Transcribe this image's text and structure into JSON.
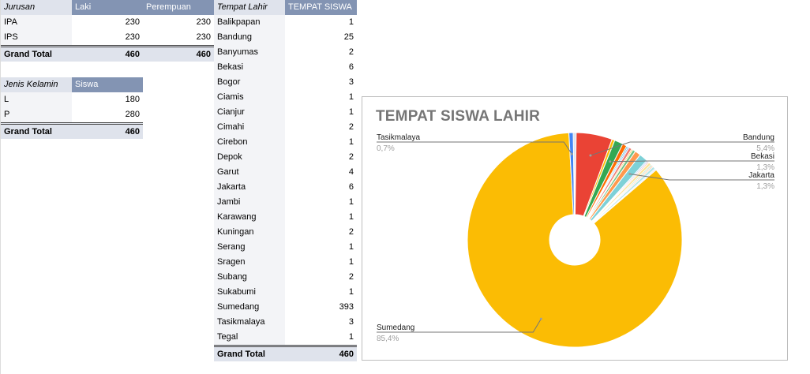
{
  "jurusan_table": {
    "headers": [
      "Jurusan",
      "Laki",
      "Perempuan"
    ],
    "rows": [
      {
        "label": "IPA",
        "laki": "230",
        "perempuan": "230"
      },
      {
        "label": "IPS",
        "laki": "230",
        "perempuan": "230"
      }
    ],
    "total": {
      "label": "Grand Total",
      "laki": "460",
      "perempuan": "460"
    }
  },
  "gender_table": {
    "headers": [
      "Jenis Kelamin",
      "Siswa"
    ],
    "rows": [
      {
        "label": "L",
        "value": "180"
      },
      {
        "label": "P",
        "value": "280"
      }
    ],
    "total": {
      "label": "Grand Total",
      "value": "460"
    }
  },
  "tempat_table": {
    "headers": [
      "Tempat Lahir",
      "TEMPAT SISWA"
    ],
    "rows": [
      {
        "label": "Balikpapan",
        "value": "1"
      },
      {
        "label": "Bandung",
        "value": "25"
      },
      {
        "label": "Banyumas",
        "value": "2"
      },
      {
        "label": "Bekasi",
        "value": "6"
      },
      {
        "label": "Bogor",
        "value": "3"
      },
      {
        "label": "Ciamis",
        "value": "1"
      },
      {
        "label": "Cianjur",
        "value": "1"
      },
      {
        "label": "Cimahi",
        "value": "2"
      },
      {
        "label": "Cirebon",
        "value": "1"
      },
      {
        "label": "Depok",
        "value": "2"
      },
      {
        "label": "Garut",
        "value": "4"
      },
      {
        "label": "Jakarta",
        "value": "6"
      },
      {
        "label": "Jambi",
        "value": "1"
      },
      {
        "label": "Karawang",
        "value": "1"
      },
      {
        "label": "Kuningan",
        "value": "2"
      },
      {
        "label": "Serang",
        "value": "1"
      },
      {
        "label": "Sragen",
        "value": "1"
      },
      {
        "label": "Subang",
        "value": "2"
      },
      {
        "label": "Sukabumi",
        "value": "1"
      },
      {
        "label": "Sumedang",
        "value": "393"
      },
      {
        "label": "Tasikmalaya",
        "value": "3"
      },
      {
        "label": "Tegal",
        "value": "1"
      }
    ],
    "total": {
      "label": "Grand Total",
      "value": "460"
    }
  },
  "chart_data": {
    "type": "pie",
    "donut": true,
    "title": "TEMPAT SISWA LAHIR",
    "slices": [
      {
        "name": "Balikpapan",
        "value": 1,
        "color": "#a8c4e6"
      },
      {
        "name": "Bandung",
        "value": 25,
        "color": "#ea4335"
      },
      {
        "name": "Banyumas",
        "value": 2,
        "color": "#fbbc04"
      },
      {
        "name": "Bekasi",
        "value": 6,
        "color": "#34a853"
      },
      {
        "name": "Bogor",
        "value": 3,
        "color": "#ff6d01"
      },
      {
        "name": "Ciamis",
        "value": 1,
        "color": "#46bdc6"
      },
      {
        "name": "Cianjur",
        "value": 1,
        "color": "#7baaf7"
      },
      {
        "name": "Cimahi",
        "value": 2,
        "color": "#f07b72"
      },
      {
        "name": "Cirebon",
        "value": 1,
        "color": "#fcd04f"
      },
      {
        "name": "Depok",
        "value": 2,
        "color": "#71c287"
      },
      {
        "name": "Garut",
        "value": 4,
        "color": "#ff994d"
      },
      {
        "name": "Jakarta",
        "value": 6,
        "color": "#7ed1d7"
      },
      {
        "name": "Jambi",
        "value": 1,
        "color": "#b3cefb"
      },
      {
        "name": "Karawang",
        "value": 1,
        "color": "#f7b4ae"
      },
      {
        "name": "Kuningan",
        "value": 2,
        "color": "#fde49b"
      },
      {
        "name": "Serang",
        "value": 1,
        "color": "#aedcba"
      },
      {
        "name": "Sragen",
        "value": 1,
        "color": "#ffc599"
      },
      {
        "name": "Subang",
        "value": 2,
        "color": "#b5e5e8"
      },
      {
        "name": "Sukabumi",
        "value": 1,
        "color": "#d9e6fd"
      },
      {
        "name": "Sumedang",
        "value": 393,
        "color": "#fbbc04"
      },
      {
        "name": "Tasikmalaya",
        "value": 3,
        "color": "#4285f4"
      },
      {
        "name": "Tegal",
        "value": 1,
        "color": "#c5cbd4"
      }
    ],
    "callouts": [
      {
        "name": "Tasikmalaya",
        "pct": "0,7%",
        "side": "left"
      },
      {
        "name": "Bandung",
        "pct": "5,4%",
        "side": "right"
      },
      {
        "name": "Bekasi",
        "pct": "1,3%",
        "side": "right"
      },
      {
        "name": "Jakarta",
        "pct": "1,3%",
        "side": "right"
      },
      {
        "name": "Sumedang",
        "pct": "85,4%",
        "side": "left"
      }
    ]
  }
}
